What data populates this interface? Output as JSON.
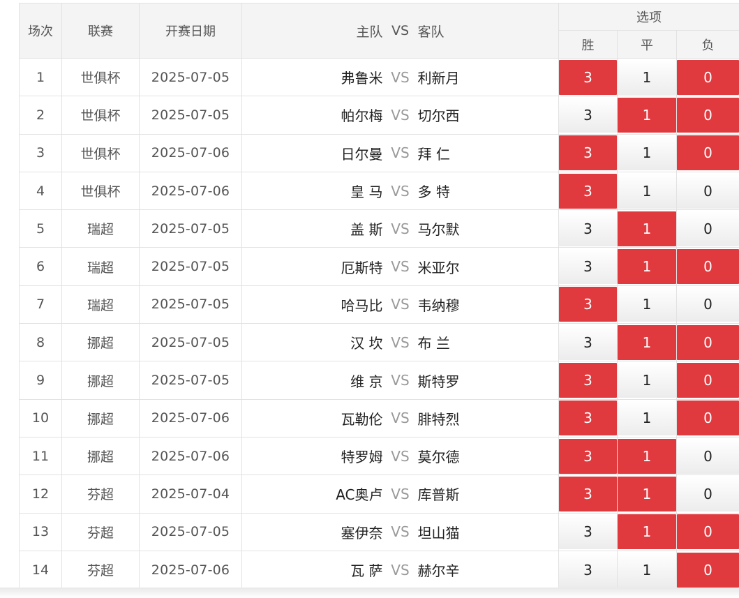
{
  "header": {
    "round_label": "场次",
    "league_label": "联赛",
    "date_label": "开赛日期",
    "home_label": "主队",
    "vs_label": "VS",
    "away_label": "客队",
    "options_label": "选项",
    "win_label": "胜",
    "draw_label": "平",
    "lose_label": "负"
  },
  "colors": {
    "selected": "#e0393e",
    "header_bg": "#f4f4f4",
    "border": "#e2e2e2"
  },
  "rows": [
    {
      "no": "1",
      "league": "世俱杯",
      "date": "2025-07-05",
      "home": "弗鲁米",
      "vs": "VS",
      "away": "利新月",
      "win": "3",
      "draw": "1",
      "lose": "0",
      "sel": [
        true,
        false,
        true
      ]
    },
    {
      "no": "2",
      "league": "世俱杯",
      "date": "2025-07-05",
      "home": "帕尔梅",
      "vs": "VS",
      "away": "切尔西",
      "win": "3",
      "draw": "1",
      "lose": "0",
      "sel": [
        false,
        true,
        true
      ]
    },
    {
      "no": "3",
      "league": "世俱杯",
      "date": "2025-07-06",
      "home": "日尔曼",
      "vs": "VS",
      "away": "拜 仁",
      "win": "3",
      "draw": "1",
      "lose": "0",
      "sel": [
        true,
        false,
        true
      ]
    },
    {
      "no": "4",
      "league": "世俱杯",
      "date": "2025-07-06",
      "home": "皇 马",
      "vs": "VS",
      "away": "多 特",
      "win": "3",
      "draw": "1",
      "lose": "0",
      "sel": [
        true,
        false,
        false
      ]
    },
    {
      "no": "5",
      "league": "瑞超",
      "date": "2025-07-05",
      "home": "盖 斯",
      "vs": "VS",
      "away": "马尔默",
      "win": "3",
      "draw": "1",
      "lose": "0",
      "sel": [
        false,
        true,
        false
      ]
    },
    {
      "no": "6",
      "league": "瑞超",
      "date": "2025-07-05",
      "home": "厄斯特",
      "vs": "VS",
      "away": "米亚尔",
      "win": "3",
      "draw": "1",
      "lose": "0",
      "sel": [
        false,
        true,
        true
      ]
    },
    {
      "no": "7",
      "league": "瑞超",
      "date": "2025-07-05",
      "home": "哈马比",
      "vs": "VS",
      "away": "韦纳穆",
      "win": "3",
      "draw": "1",
      "lose": "0",
      "sel": [
        true,
        false,
        false
      ]
    },
    {
      "no": "8",
      "league": "挪超",
      "date": "2025-07-05",
      "home": "汉 坎",
      "vs": "VS",
      "away": "布 兰",
      "win": "3",
      "draw": "1",
      "lose": "0",
      "sel": [
        false,
        true,
        true
      ]
    },
    {
      "no": "9",
      "league": "挪超",
      "date": "2025-07-05",
      "home": "维 京",
      "vs": "VS",
      "away": "斯特罗",
      "win": "3",
      "draw": "1",
      "lose": "0",
      "sel": [
        true,
        false,
        true
      ]
    },
    {
      "no": "10",
      "league": "挪超",
      "date": "2025-07-06",
      "home": "瓦勒伦",
      "vs": "VS",
      "away": "腓特烈",
      "win": "3",
      "draw": "1",
      "lose": "0",
      "sel": [
        true,
        false,
        true
      ]
    },
    {
      "no": "11",
      "league": "挪超",
      "date": "2025-07-06",
      "home": "特罗姆",
      "vs": "VS",
      "away": "莫尔德",
      "win": "3",
      "draw": "1",
      "lose": "0",
      "sel": [
        true,
        true,
        false
      ]
    },
    {
      "no": "12",
      "league": "芬超",
      "date": "2025-07-04",
      "home": "AC奥卢",
      "vs": "VS",
      "away": "库普斯",
      "win": "3",
      "draw": "1",
      "lose": "0",
      "sel": [
        true,
        true,
        false
      ]
    },
    {
      "no": "13",
      "league": "芬超",
      "date": "2025-07-05",
      "home": "塞伊奈",
      "vs": "VS",
      "away": "坦山猫",
      "win": "3",
      "draw": "1",
      "lose": "0",
      "sel": [
        false,
        true,
        true
      ]
    },
    {
      "no": "14",
      "league": "芬超",
      "date": "2025-07-06",
      "home": "瓦 萨",
      "vs": "VS",
      "away": "赫尔辛",
      "win": "3",
      "draw": "1",
      "lose": "0",
      "sel": [
        false,
        false,
        true
      ]
    }
  ]
}
